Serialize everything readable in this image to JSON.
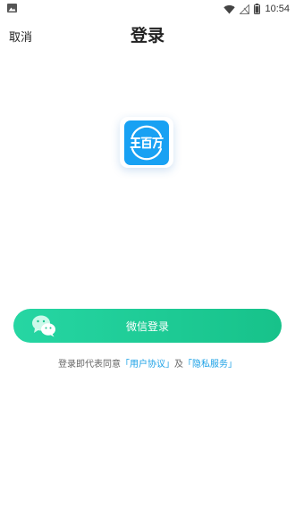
{
  "status_bar": {
    "time": "10:54",
    "icons": [
      "image-icon",
      "wifi-icon",
      "no-signal-icon",
      "battery-icon"
    ]
  },
  "header": {
    "cancel_label": "取消",
    "title": "登录"
  },
  "logo": {
    "brand_text": "王百万",
    "background_color": "#18a1f3"
  },
  "wechat_login": {
    "label": "微信登录",
    "icon": "wechat-icon",
    "gradient": [
      "#26d6a3",
      "#17c28a"
    ]
  },
  "agreement": {
    "prefix": "登录即代表同意",
    "user_agreement": "「用户协议」",
    "conjunction": "及",
    "privacy_policy": "「隐私服务」",
    "link_color": "#1aa0e6"
  }
}
